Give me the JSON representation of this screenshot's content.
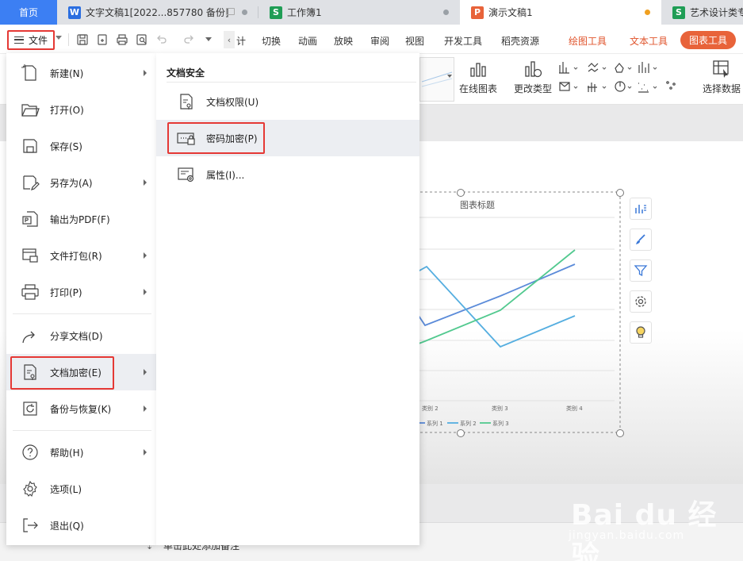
{
  "tabs": {
    "home": "首页",
    "doc1": "文字文稿1[2022...857780 备份]",
    "doc2": "工作簿1",
    "doc3": "演示文稿1",
    "doc4": "艺术设计类专"
  },
  "colors": {
    "home_tab": "#3c7ff3",
    "writer_icon": "#2b6ee0",
    "sheet_icon": "#1f9d55",
    "ppt_icon": "#e8633a",
    "highlight_box": "#e53935"
  },
  "menubar": {
    "file_label": "文件",
    "tabs": [
      "计",
      "切换",
      "动画",
      "放映",
      "审阅",
      "视图",
      "开发工具",
      "稻壳资源"
    ],
    "context_tabs": [
      "绘图工具",
      "文本工具"
    ],
    "active_context_tab": "图表工具"
  },
  "ribbon": {
    "online_chart": "在线图表",
    "change_type": "更改类型",
    "select_data": "选择数据"
  },
  "chart": {
    "title": "图表标题",
    "categories": [
      "类别 2",
      "类别 3",
      "类别 4"
    ],
    "legend": [
      "系列 1",
      "系列 2",
      "系列 3"
    ]
  },
  "chart_data": {
    "type": "line",
    "title": "图表标题",
    "categories": [
      "类别 2",
      "类别 3",
      "类别 4"
    ],
    "series": [
      {
        "name": "系列 1",
        "color": "#5b8bd9"
      },
      {
        "name": "系列 2",
        "color": "#55aee0"
      },
      {
        "name": "系列 3",
        "color": "#52c98f"
      }
    ],
    "legend_position": "bottom"
  },
  "file_menu": {
    "items": [
      {
        "label": "新建(N)",
        "icon": "new-file-icon",
        "arrow": true
      },
      {
        "label": "打开(O)",
        "icon": "folder-open-icon",
        "arrow": false
      },
      {
        "label": "保存(S)",
        "icon": "save-icon",
        "arrow": false
      },
      {
        "label": "另存为(A)",
        "icon": "save-as-icon",
        "arrow": true
      },
      {
        "label": "输出为PDF(F)",
        "icon": "pdf-export-icon",
        "arrow": false
      },
      {
        "label": "文件打包(R)",
        "icon": "package-icon",
        "arrow": true
      },
      {
        "label": "打印(P)",
        "icon": "print-icon",
        "arrow": true
      },
      {
        "label": "分享文档(D)",
        "icon": "share-icon",
        "arrow": false
      },
      {
        "label": "文档加密(E)",
        "icon": "document-lock-icon",
        "arrow": true,
        "active": true
      },
      {
        "label": "备份与恢复(K)",
        "icon": "backup-restore-icon",
        "arrow": true
      },
      {
        "label": "帮助(H)",
        "icon": "help-icon",
        "arrow": true
      },
      {
        "label": "选项(L)",
        "icon": "gear-icon",
        "arrow": false
      },
      {
        "label": "退出(Q)",
        "icon": "exit-icon",
        "arrow": false
      }
    ]
  },
  "submenu": {
    "title": "文档安全",
    "items": [
      {
        "label": "文档权限(U)",
        "icon": "document-permission-icon"
      },
      {
        "label": "密码加密(P)",
        "icon": "password-lock-icon",
        "active": true
      },
      {
        "label": "属性(I)...",
        "icon": "properties-icon"
      }
    ]
  },
  "notes": {
    "placeholder": "单击此处添加备注"
  },
  "watermark": {
    "main": "Bai du 经验",
    "url": "jingyan.baidu.com"
  }
}
